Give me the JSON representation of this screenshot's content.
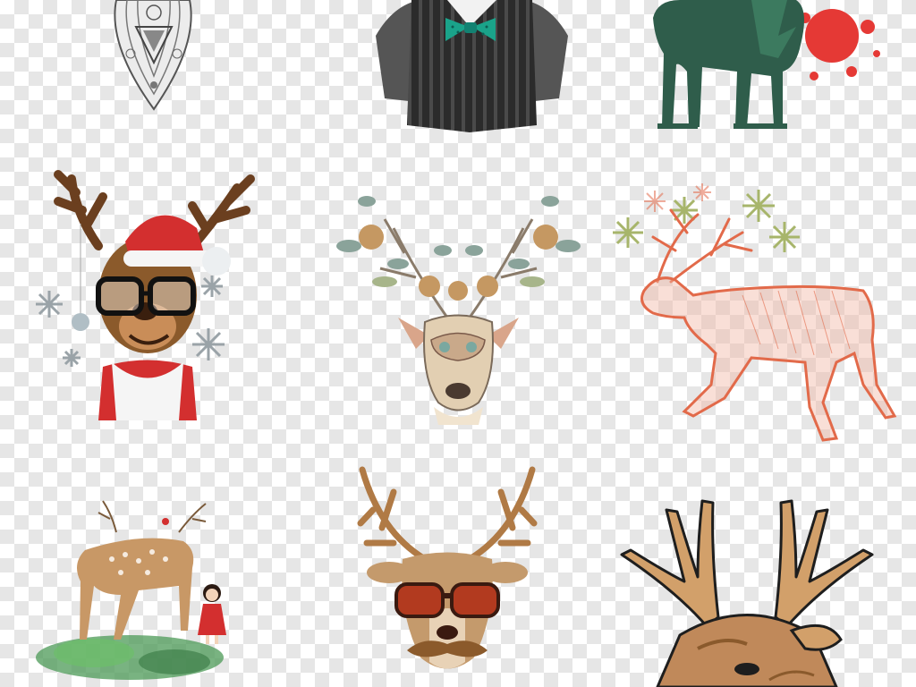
{
  "canvas": {
    "background": "transparency-checkerboard",
    "checker_colors": [
      "#ffffff",
      "#e6e6e6"
    ]
  },
  "tiles": [
    {
      "id": "ornate-feather-pendant",
      "row": 1,
      "col": 1,
      "colors": [
        "#6e6e6e",
        "#e8e8e8"
      ]
    },
    {
      "id": "striped-vest-with-bowtie",
      "row": 1,
      "col": 2,
      "colors": [
        "#2f2f2f",
        "#1aa38a"
      ]
    },
    {
      "id": "green-deer-with-red-splash",
      "row": 1,
      "col": 3,
      "colors": [
        "#2f5d4b",
        "#e53935"
      ]
    },
    {
      "id": "santa-hat-cartoon-reindeer",
      "row": 2,
      "col": 1,
      "colors": [
        "#8b5a2b",
        "#d32f2f",
        "#b0bec5"
      ]
    },
    {
      "id": "floral-antler-deer-head",
      "row": 2,
      "col": 2,
      "colors": [
        "#d9c4a5",
        "#8aa39a",
        "#c59862"
      ]
    },
    {
      "id": "sketched-red-reindeer-snowflakes",
      "row": 2,
      "col": 3,
      "colors": [
        "#e26a4a",
        "#a7b56b"
      ]
    },
    {
      "id": "watercolor-fawn-with-children",
      "row": 3,
      "col": 1,
      "colors": [
        "#c89866",
        "#4c9a57",
        "#d32f2f"
      ]
    },
    {
      "id": "deer-with-sunglasses-mustache",
      "row": 3,
      "col": 2,
      "colors": [
        "#c49a6c",
        "#b23a1f",
        "#8b5a2b"
      ]
    },
    {
      "id": "realistic-buck-antlers",
      "row": 3,
      "col": 3,
      "colors": [
        "#d2a06a",
        "#8a5a2c",
        "#1e1e1e"
      ]
    }
  ]
}
